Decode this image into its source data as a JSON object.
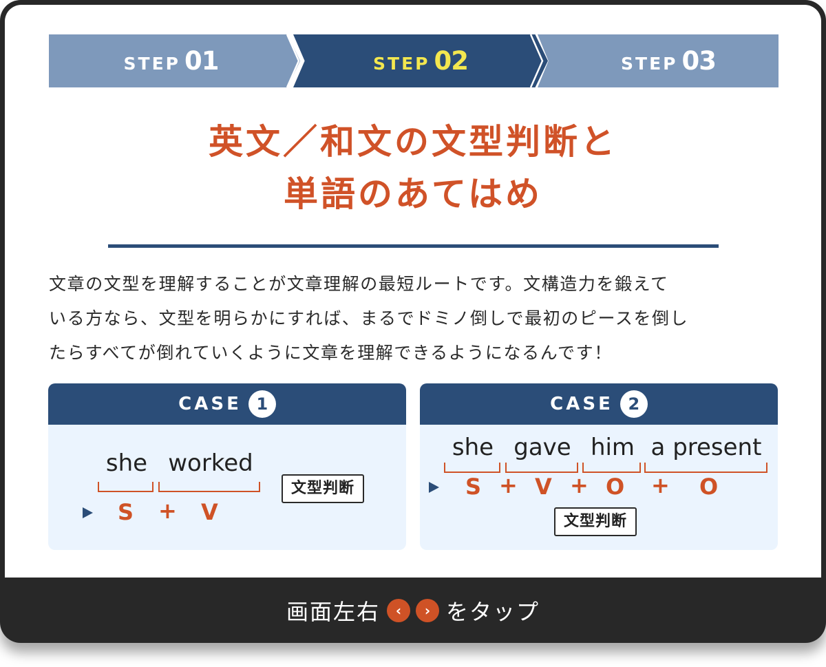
{
  "steps": [
    {
      "label": "STEP",
      "number": "01",
      "active": false
    },
    {
      "label": "STEP",
      "number": "02",
      "active": true
    },
    {
      "label": "STEP",
      "number": "03",
      "active": false
    }
  ],
  "title": {
    "line1": "英文／和文の文型判断と",
    "line2": "単語のあてはめ"
  },
  "description": {
    "line1": "文章の文型を理解することが文章理解の最短ルートです。文構造力を鍛えて",
    "line2": "いる方なら、文型を明らかにすれば、まるでドミノ倒しで最初のピースを倒し",
    "line3": "たらすべてが倒れていくように文章を理解できるようになるんです！"
  },
  "cases": [
    {
      "label": "CASE",
      "number": "1",
      "words": [
        "she",
        "worked"
      ],
      "roles": [
        "S",
        "+",
        "V"
      ],
      "judge_label": "文型判断"
    },
    {
      "label": "CASE",
      "number": "2",
      "words": [
        "she",
        "gave",
        "him",
        "a present"
      ],
      "roles": [
        "S",
        "+",
        "V",
        "+",
        "O",
        "+",
        "O"
      ],
      "judge_label": "文型判断"
    }
  ],
  "bottom": {
    "prefix": "画面左右",
    "prev_icon": "‹",
    "next_icon": "›",
    "suffix": "をタップ"
  },
  "colors": {
    "accent": "#d05228",
    "navy": "#2b4d78",
    "step_inactive": "#7e99bb",
    "step_active_text": "#f3e74f",
    "case_bg": "#ebf4fe",
    "frame": "#282828"
  }
}
